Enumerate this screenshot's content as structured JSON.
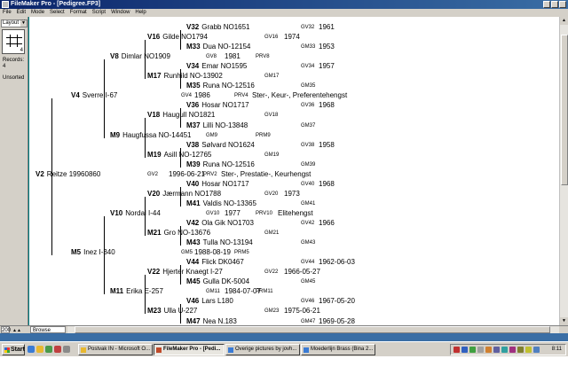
{
  "window": {
    "title": "FileMaker Pro - [Pedigree.FP3]"
  },
  "menu": [
    "File",
    "Edit",
    "Mode",
    "Select",
    "Format",
    "Script",
    "Window",
    "Help"
  ],
  "status": {
    "layout": "Layout #1",
    "book_page": "4",
    "records_label": "Records:",
    "records_value": "4",
    "sort_state": "Unsorted"
  },
  "bottombar": {
    "zoom": "200",
    "mode": "Browse"
  },
  "pedigree": {
    "nodes": [
      {
        "label": "V32",
        "name": "Grabb NO1651",
        "code": "GV32",
        "year": "1961"
      },
      {
        "label": "V16",
        "name": "Gilde NO1794",
        "code": "GV16",
        "year": "1974"
      },
      {
        "label": "M33",
        "name": "Dua NO-12154",
        "code": "GM33",
        "year": "1953"
      },
      {
        "label": "V8",
        "name": "Dimlar NO1909",
        "code": "GV8",
        "year": "1981",
        "code2": "PRV8"
      },
      {
        "label": "V34",
        "name": "Emar NO1595",
        "code": "GV34",
        "year": "1957"
      },
      {
        "label": "M17",
        "name": "Runhild NO-13902",
        "code": "GM17"
      },
      {
        "label": "M35",
        "name": "Runa NO-12516",
        "code": "GM35"
      },
      {
        "label": "V4",
        "name": "Sverre I-67",
        "code": "GV4",
        "year": "1986",
        "code2": "PRV4",
        "extra": "Ster-, Keur-, Preferentehengst"
      },
      {
        "label": "V36",
        "name": "Hosar NO1717",
        "code": "GV36",
        "year": "1968"
      },
      {
        "label": "V18",
        "name": "Haugull NO1821",
        "code": "GV18"
      },
      {
        "label": "M37",
        "name": "Lilli NO-13848",
        "code": "GM37"
      },
      {
        "label": "M9",
        "name": "Haugfussa NO-14451",
        "code": "GM9",
        "code2": "PRM9"
      },
      {
        "label": "V38",
        "name": "Sølvard NO1624",
        "code": "GV38",
        "year": "1958"
      },
      {
        "label": "M19",
        "name": "Asill NO-12765",
        "code": "GM19"
      },
      {
        "label": "M39",
        "name": "Runa NO-12516",
        "code": "GM39"
      },
      {
        "label": "V2",
        "name": "Reitze 19960860",
        "code": "GV2",
        "year": "1996-06-21",
        "code2": "PRV2",
        "extra": "Ster-, Prestatie-, Keurhengst"
      },
      {
        "label": "V40",
        "name": "Hosar NO1717",
        "code": "GV40",
        "year": "1968"
      },
      {
        "label": "V20",
        "name": "Jærmann NO1788",
        "code": "GV20",
        "year": "1973"
      },
      {
        "label": "M41",
        "name": "Valdis NO-13365",
        "code": "GM41"
      },
      {
        "label": "V10",
        "name": "Nordal I-44",
        "code": "GV10",
        "year": "1977",
        "code2": "PRV10",
        "extra": "Elitehengst"
      },
      {
        "label": "V42",
        "name": "Ola Gik NO1703",
        "code": "GV42",
        "year": "1966"
      },
      {
        "label": "M21",
        "name": "Gro NO-13676",
        "code": "GM21"
      },
      {
        "label": "M43",
        "name": "Tulla NO-13194",
        "code": "GM43"
      },
      {
        "label": "M5",
        "name": "Inez I-340",
        "code": "GM5",
        "year": "1988-08-19",
        "code2": "PRM5"
      },
      {
        "label": "V44",
        "name": "Flick DK0467",
        "code": "GV44",
        "year": "1962-06-03"
      },
      {
        "label": "V22",
        "name": "Hjerter Knaegt I-27",
        "code": "GV22",
        "year": "1966-05-27"
      },
      {
        "label": "M45",
        "name": "Gulla DK-5004",
        "code": "GM45"
      },
      {
        "label": "M11",
        "name": "Erika E-257",
        "code": "GM11",
        "year": "1984-07-07",
        "code2": "PRM11"
      },
      {
        "label": "V46",
        "name": "Lars L180",
        "code": "GV46",
        "year": "1967-05-20"
      },
      {
        "label": "M23",
        "name": "Ulla U-227",
        "code": "GM23",
        "year": "1975-06-21"
      },
      {
        "label": "M47",
        "name": "Nea N.183",
        "code": "GM47",
        "year": "1969-05-28"
      }
    ]
  },
  "taskbar": {
    "start": "Start",
    "tasks": [
      {
        "label": "Postvak IN - Microsoft O...",
        "active": false
      },
      {
        "label": "FileMaker Pro - [Pedi...",
        "active": true
      },
      {
        "label": "Overige pictures by jovh...",
        "active": false
      },
      {
        "label": "Moederlijn Brass (Bina 2...",
        "active": false
      }
    ],
    "clock": "8:11"
  }
}
